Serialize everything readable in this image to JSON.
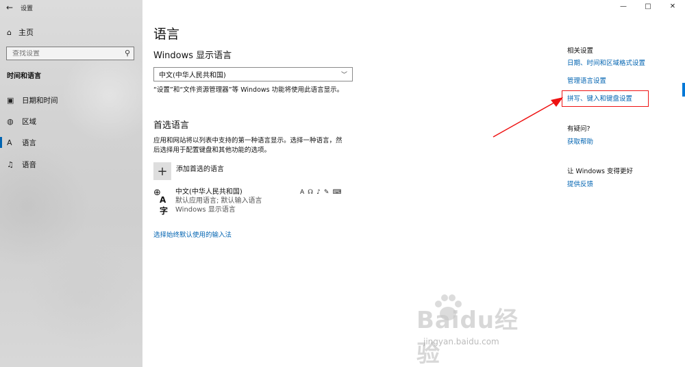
{
  "window": {
    "title": "设置",
    "back_icon": "←",
    "controls": {
      "minimize": "—",
      "maximize": "□",
      "close": "✕"
    }
  },
  "sidebar": {
    "home_label": "主页",
    "search_placeholder": "查找设置",
    "section_title": "时间和语言",
    "items": [
      {
        "label": "日期和时间",
        "icon": "calendar-clock-icon"
      },
      {
        "label": "区域",
        "icon": "globe-region-icon"
      },
      {
        "label": "语言",
        "icon": "language-icon",
        "active": true
      },
      {
        "label": "语音",
        "icon": "microphone-icon"
      }
    ]
  },
  "main": {
    "title": "语言",
    "display_language": {
      "heading": "Windows 显示语言",
      "selected": "中文(中华人民共和国)",
      "note": "“设置”和“文件资源管理器”等 Windows 功能将使用此语言显示。"
    },
    "preferred": {
      "heading": "首选语言",
      "description_line1": "应用和网站将以列表中支持的第一种语言显示。选择一种语言，然",
      "description_line2": "后选择用于配置键盘和其他功能的选项。",
      "add_label": "添加首选的语言",
      "language": {
        "name": "中文(中华人民共和国)",
        "sub1": "默认应用语言; 默认输入语言",
        "sub2": "Windows 显示语言"
      }
    },
    "input_method_link": "选择始终默认使用的输入法"
  },
  "related": {
    "heading": "相关设置",
    "links": [
      "日期、时间和区域格式设置",
      "管理语言设置",
      "拼写、键入和键盘设置"
    ],
    "question_heading": "有疑问?",
    "help_link": "获取帮助",
    "improve_heading": "让 Windows 变得更好",
    "feedback_link": "提供反馈"
  },
  "watermark": {
    "text": "Baidu经验",
    "sub": "jingyan.baidu.com"
  },
  "colors": {
    "accent": "#0063b1",
    "highlight_box": "#e11111",
    "sidebar_bg": "#d4d4d4"
  }
}
